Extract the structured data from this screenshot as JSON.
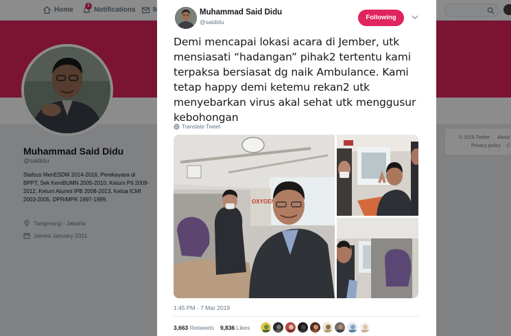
{
  "nav": {
    "home_label": "Home",
    "notifications_label": "Notifications",
    "notifications_count": "1",
    "messages_label": "M"
  },
  "profile": {
    "name": "Muhammad Said Didu",
    "handle": "@saididu",
    "bio": "Stafsus MenESDM 2014-2016, Perekayasa di BPPT, Sek KemBUMN 2005-2010, Ketum PII 2009-2012, Ketum Alumni IPB 2008-2013, Ketua ICMI 2003-2005, DPR/MPR 1997-1999.",
    "location": "Tangerang - Jakarta",
    "joined": "Joined January 2011",
    "banner_color": "#e0245e"
  },
  "footer": {
    "copyright": "© 2019 Twitter",
    "about": "About",
    "privacy": "Privacy policy",
    "cookies": "C"
  },
  "tweet": {
    "author_name": "Muhammad Said Didu",
    "author_handle": "@saididu",
    "follow_label": "Following",
    "text": "Demi mencapai lokasi acara di Jember, utk mensiasati “hadangan” pihak2 tertentu kami terpaksa bersiasat dg naik Ambulance. Kami tetap happy demi ketemu rekan2 utk menyebarkan virus akal sehat utk menggusur kebohongan",
    "translate_label": "Translate Tweet",
    "timestamp": "1:45 PM - 7 Mar 2019",
    "retweets_count": "3,663",
    "retweets_label": "Retweets",
    "likes_count": "9,836",
    "likes_label": "Likes",
    "ambulance_sign": "OXYGEN",
    "accent_color": "#e0245e"
  }
}
